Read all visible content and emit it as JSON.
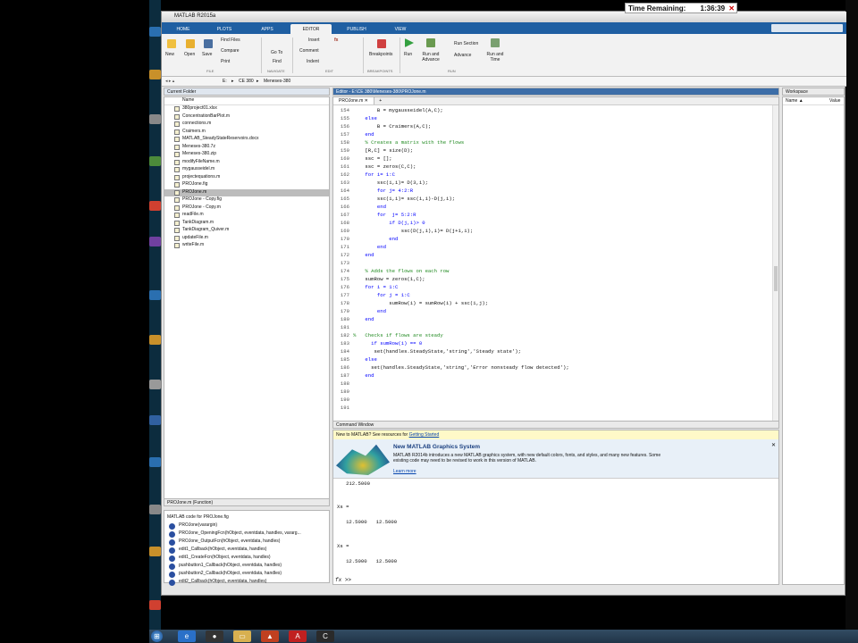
{
  "timer": {
    "label": "Time Remaining:",
    "value": "1:36:39"
  },
  "window": {
    "title": "MATLAB R2015a"
  },
  "tabs": [
    "HOME",
    "PLOTS",
    "APPS",
    "EDITOR",
    "PUBLISH",
    "VIEW"
  ],
  "ribbon": {
    "new": "New",
    "open": "Open",
    "save": "Save",
    "find_files": "Find Files",
    "compare": "Compare",
    "print": "Print",
    "goto": "Go To",
    "find": "Find",
    "insert": "Insert",
    "comment": "Comment",
    "indent": "Indent",
    "breakpoints": "Breakpoints",
    "run": "Run",
    "run_advance": "Run and Advance",
    "run_section": "Run Section",
    "advance": "Advance",
    "run_time": "Run and Time",
    "groups": [
      "FILE",
      "NAVIGATE",
      "EDIT",
      "BREAKPOINTS",
      "RUN"
    ]
  },
  "address": {
    "path": [
      "E:",
      "CE 380",
      "Meneses-380"
    ]
  },
  "folder": {
    "title": "Current Folder",
    "col": "Name",
    "files": [
      "380project01.xlsx",
      "ConcentrationBarPlot.m",
      "connections.m",
      "Craimers.m",
      "MATLAB_SteadyStateReservoirs.docx",
      "Meneses-380.7z",
      "Meneses-380.zip",
      "modifyFileName.m",
      "mygausseidel.m",
      "projectequations.m",
      "PROJone.fig",
      "PROJone.m",
      "PROJone - Copy.fig",
      "PROJone - Copy.m",
      "readFile.m",
      "TankDiagram.m",
      "TankDiagram_Quiver.m",
      "updateFile.m",
      "writeFile.m"
    ],
    "selected": "PROJone.m"
  },
  "details": {
    "title": "PROJone.m (Function)",
    "desc": "MATLAB code for PROJone.fig",
    "items": [
      "PROJone(varargin)",
      "PROJone_OpeningFcn(hObject, eventdata, handles, vararg...",
      "PROJone_OutputFcn(hObject, eventdata, handles)",
      "edit1_Callback(hObject, eventdata, handles)",
      "edit1_CreateFcn(hObject, eventdata, handles)",
      "pushbutton1_Callback(hObject, eventdata, handles)",
      "pushbutton2_Callback(hObject, eventdata, handles)",
      "edit2_Callback(hObject, eventdata, handles)"
    ]
  },
  "editor": {
    "title": "Editor - E:\\CE 380\\Meneses-380\\PROJone.m",
    "tab": "PROJone.m",
    "lines": [
      {
        "n": "154",
        "t": "        B = mygausseidel(A,C);",
        "c": ""
      },
      {
        "n": "155",
        "t": "    else",
        "c": "kw"
      },
      {
        "n": "156",
        "t": "        B = Craimers(A,C);",
        "c": ""
      },
      {
        "n": "157",
        "t": "    end",
        "c": "kw"
      },
      {
        "n": "158",
        "t": "    % Creates a matrix with the flows",
        "c": "cm"
      },
      {
        "n": "159",
        "t": "    [R,C] = size(D);",
        "c": ""
      },
      {
        "n": "160",
        "t": "    ssc = [];",
        "c": ""
      },
      {
        "n": "161",
        "t": "    ssc = zeros(C,C);",
        "c": ""
      },
      {
        "n": "162",
        "t": "    for i= 1:C",
        "c": "kw"
      },
      {
        "n": "163",
        "t": "        ssc(i,i)= D(3,i);",
        "c": ""
      },
      {
        "n": "164",
        "t": "        for j= 4:2:R",
        "c": "kw"
      },
      {
        "n": "165",
        "t": "        ssc(i,i)= ssc(i,i)-D(j,i);",
        "c": ""
      },
      {
        "n": "166",
        "t": "        end",
        "c": "kw"
      },
      {
        "n": "167",
        "t": "        for  j= 5:2:R",
        "c": "kw"
      },
      {
        "n": "168",
        "t": "            if D(j,i)> 0",
        "c": "kw"
      },
      {
        "n": "169",
        "t": "                ssc(D(j,i),i)= D(j+1,i);",
        "c": ""
      },
      {
        "n": "170",
        "t": "            end",
        "c": "kw"
      },
      {
        "n": "171",
        "t": "        end",
        "c": "kw"
      },
      {
        "n": "172",
        "t": "    end",
        "c": "kw"
      },
      {
        "n": "173",
        "t": "",
        "c": ""
      },
      {
        "n": "174",
        "t": "    % Adds the flows on each row",
        "c": "cm"
      },
      {
        "n": "175",
        "t": "    sumRow = zeros(1,C);",
        "c": ""
      },
      {
        "n": "176",
        "t": "    for i = 1:C",
        "c": "kw"
      },
      {
        "n": "177",
        "t": "        for j = 1:C",
        "c": "kw"
      },
      {
        "n": "178",
        "t": "            sumRow(i) = sumRow(i) + ssc(i,j);",
        "c": ""
      },
      {
        "n": "179",
        "t": "        end",
        "c": "kw"
      },
      {
        "n": "180",
        "t": "    end",
        "c": "kw"
      },
      {
        "n": "181",
        "t": "",
        "c": ""
      },
      {
        "n": "182",
        "t": "%   Checks if flows are steady",
        "c": "cm"
      },
      {
        "n": "183",
        "t": "      if sumRow(i) == 0",
        "c": "kw"
      },
      {
        "n": "184",
        "t": "       set(handles.SteadyState,'string','Steady state');",
        "c": ""
      },
      {
        "n": "185",
        "t": "    else",
        "c": "kw"
      },
      {
        "n": "186",
        "t": "      set(handles.SteadyState,'string','Error nonsteady flow detected');",
        "c": ""
      },
      {
        "n": "187",
        "t": "    end",
        "c": "kw"
      },
      {
        "n": "188",
        "t": "",
        "c": ""
      },
      {
        "n": "189",
        "t": "",
        "c": ""
      },
      {
        "n": "190",
        "t": "",
        "c": ""
      },
      {
        "n": "191",
        "t": "",
        "c": ""
      }
    ]
  },
  "command": {
    "title": "Command Window",
    "notice": "New to MATLAB? See resources for",
    "notice_link": "Getting Started",
    "banner_title": "New MATLAB Graphics System",
    "banner_text": "MATLAB R2014b introduces a new MATLAB graphics system, with new default colors, fonts, and styles, and many new features.  Some existing code may need to be revised to work in this version of MATLAB.",
    "banner_link": "Learn more",
    "output": [
      "   212.5000",
      "",
      "",
      "Xs =",
      "",
      "   12.5000   12.5000",
      "",
      "",
      "Xs =",
      "",
      "   12.5000   12.5000"
    ],
    "prompt": ">>"
  },
  "workspace": {
    "title": "Workspace",
    "col_name": "Name ▲",
    "col_value": "Value"
  },
  "colors": {
    "accent": "#1f5fa2",
    "panel_header": "#3d6ea8"
  }
}
